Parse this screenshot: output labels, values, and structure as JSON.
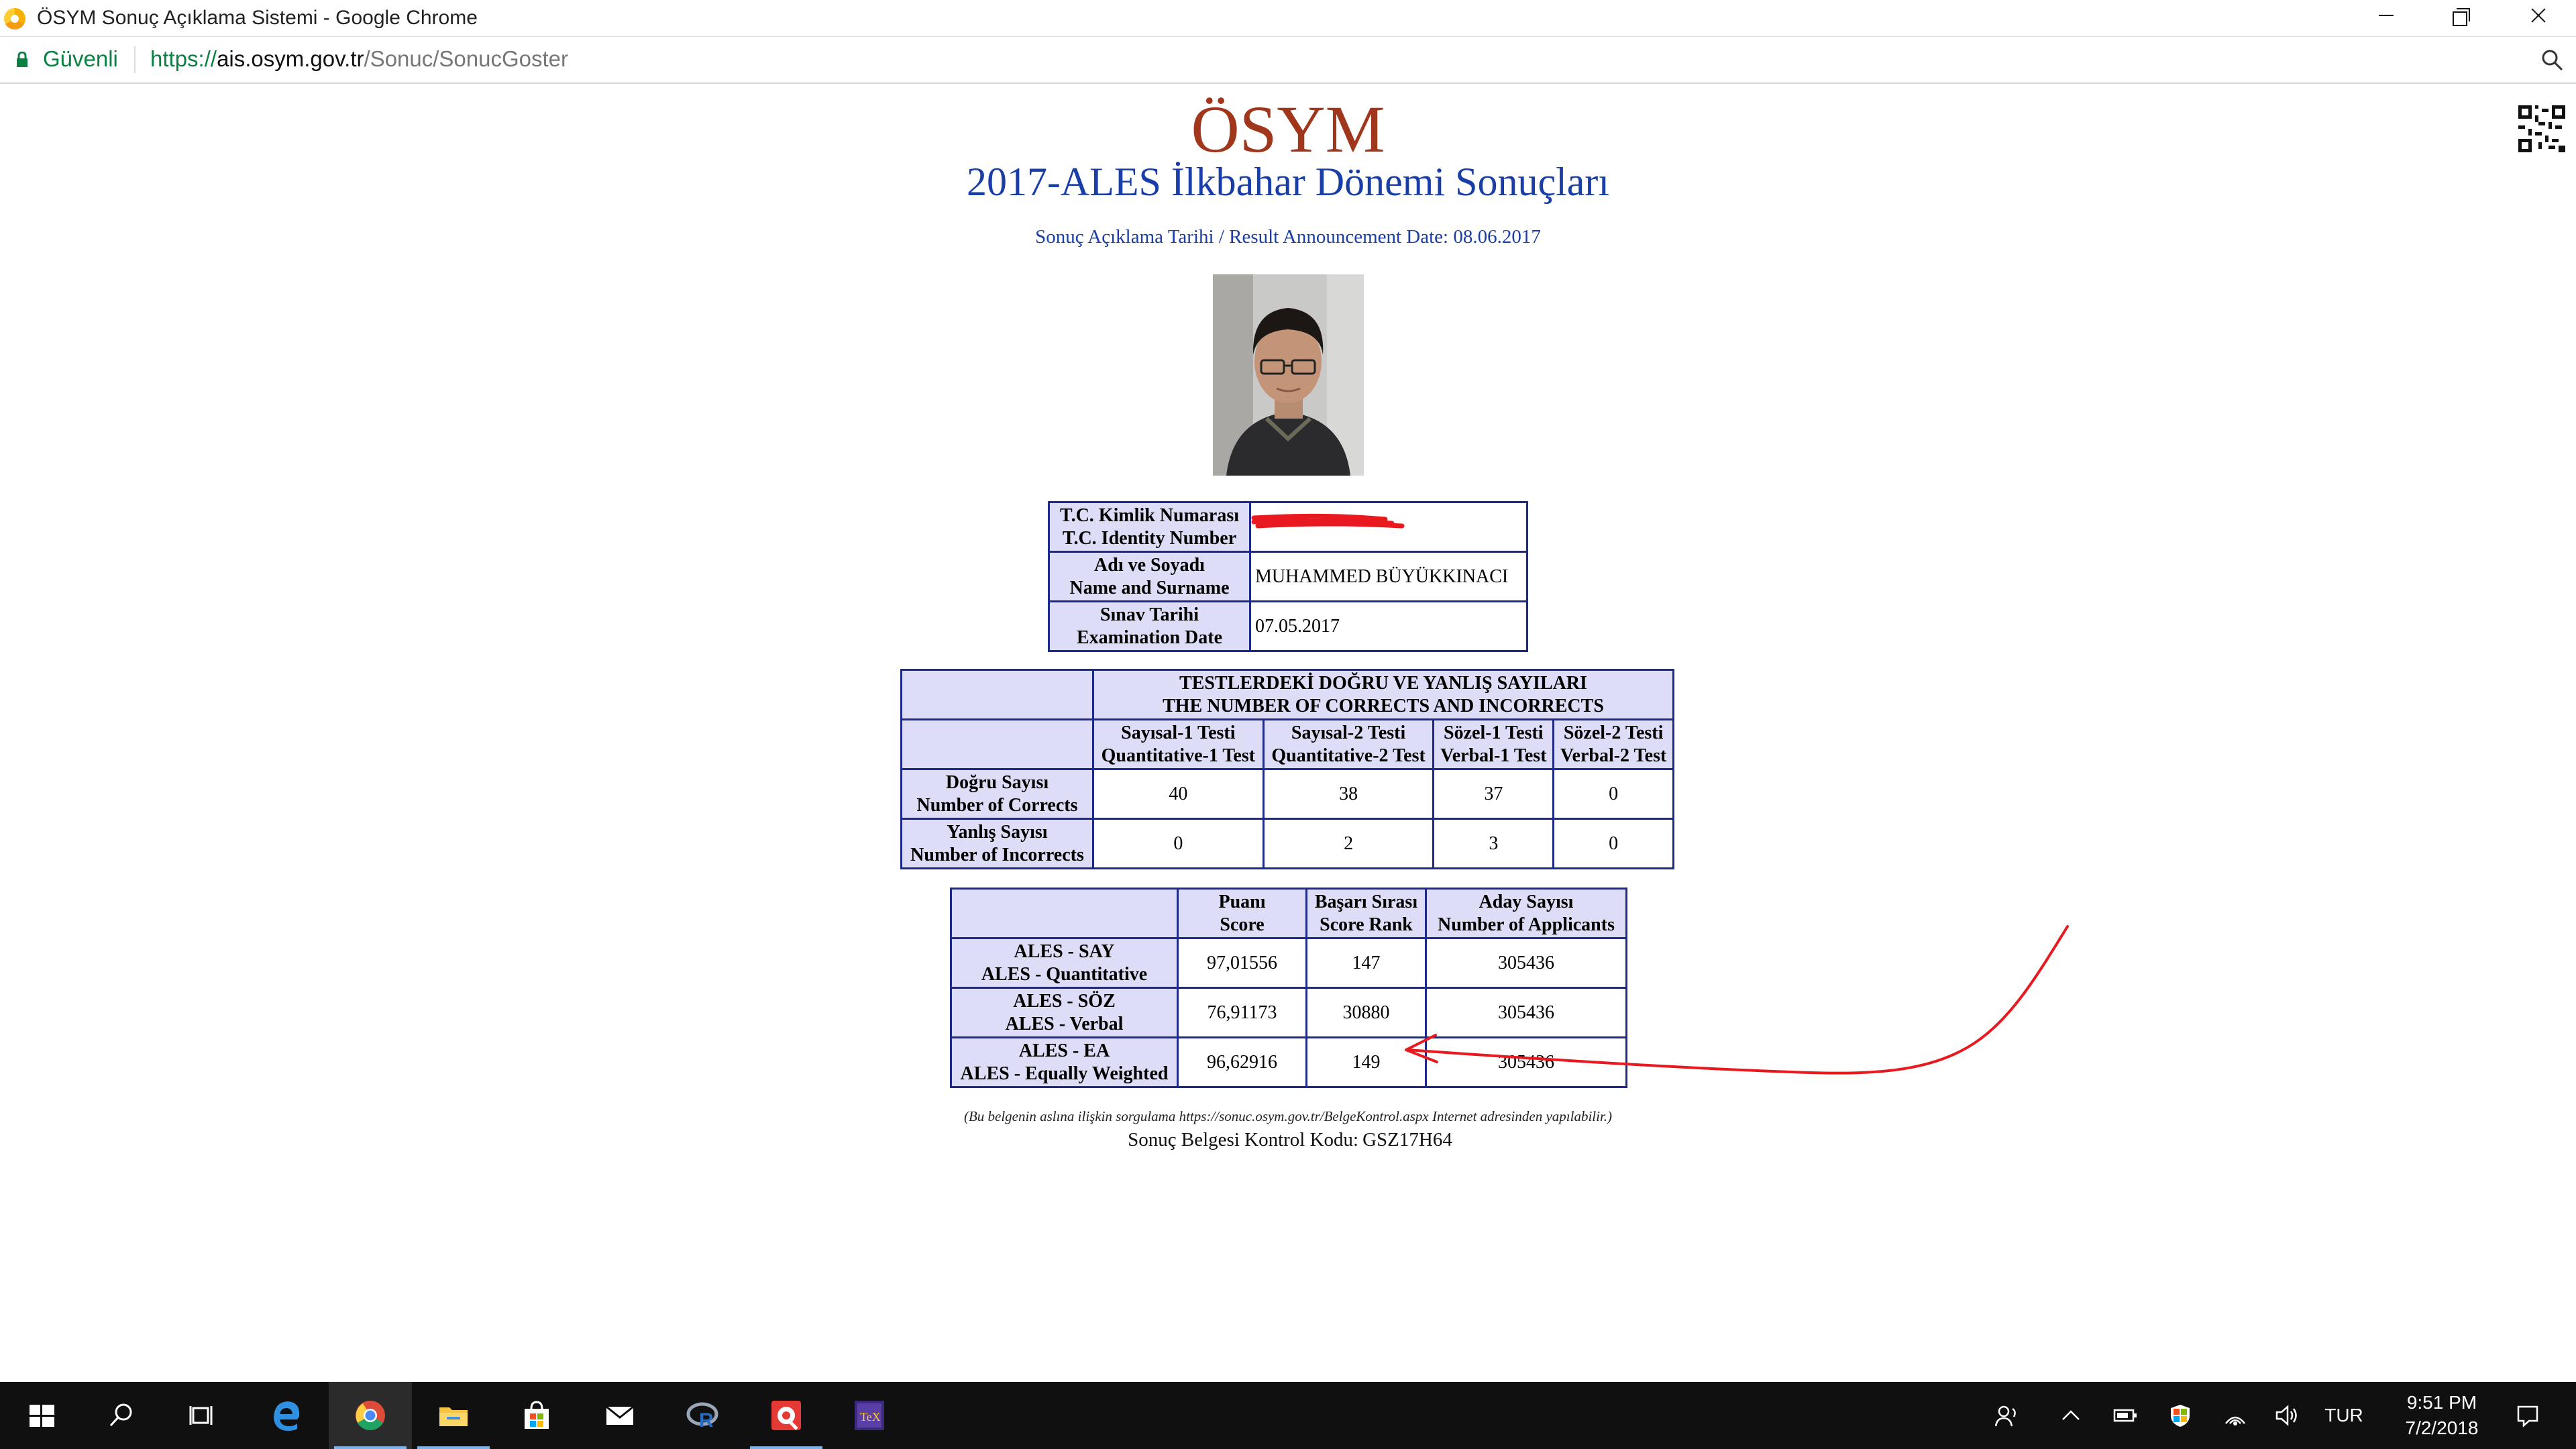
{
  "window": {
    "title": "ÖSYM Sonuç Açıklama Sistemi - Google Chrome"
  },
  "addressbar": {
    "secure_label": "Güvenli",
    "url_scheme": "https://",
    "url_host": "ais.osym.gov.tr",
    "url_path": "/Sonuc/SonucGoster"
  },
  "page": {
    "logo_text": "ÖSYM",
    "title": "2017-ALES İlkbahar Dönemi Sonuçları",
    "announcement": "Sonuç Açıklama Tarihi / Result Announcement Date: 08.06.2017",
    "identity": {
      "rows": [
        {
          "label_tr": "T.C. Kimlik Numarası",
          "label_en": "T.C. Identity Number",
          "value": ""
        },
        {
          "label_tr": "Adı ve Soyadı",
          "label_en": "Name and Surname",
          "value": "MUHAMMED BÜYÜKKINACI"
        },
        {
          "label_tr": "Sınav Tarihi",
          "label_en": "Examination Date",
          "value": "07.05.2017"
        }
      ]
    },
    "answers": {
      "heading_tr": "TESTLERDEKİ DOĞRU VE YANLIŞ SAYILARI",
      "heading_en": "THE NUMBER OF CORRECTS AND INCORRECTS",
      "columns": [
        {
          "tr": "Sayısal-1 Testi",
          "en": "Quantitative-1 Test"
        },
        {
          "tr": "Sayısal-2 Testi",
          "en": "Quantitative-2 Test"
        },
        {
          "tr": "Sözel-1 Testi",
          "en": "Verbal-1 Test"
        },
        {
          "tr": "Sözel-2 Testi",
          "en": "Verbal-2 Test"
        }
      ],
      "rows": [
        {
          "label_tr": "Doğru Sayısı",
          "label_en": "Number of Corrects",
          "values": [
            "40",
            "38",
            "37",
            "0"
          ]
        },
        {
          "label_tr": "Yanlış Sayısı",
          "label_en": "Number of Incorrects",
          "values": [
            "0",
            "2",
            "3",
            "0"
          ]
        }
      ]
    },
    "scores": {
      "columns": [
        {
          "tr": "Puanı",
          "en": "Score"
        },
        {
          "tr": "Başarı Sırası",
          "en": "Score Rank"
        },
        {
          "tr": "Aday Sayısı",
          "en": "Number of Applicants"
        }
      ],
      "rows": [
        {
          "label_tr": "ALES - SAY",
          "label_en": "ALES - Quantitative",
          "score": "97,01556",
          "rank": "147",
          "applicants": "305436"
        },
        {
          "label_tr": "ALES - SÖZ",
          "label_en": "ALES - Verbal",
          "score": "76,91173",
          "rank": "30880",
          "applicants": "305436"
        },
        {
          "label_tr": "ALES - EA",
          "label_en": "ALES - Equally Weighted",
          "score": "96,62916",
          "rank": "149",
          "applicants": "305436"
        }
      ]
    },
    "note": "(Bu belgenin aslına ilişkin sorgulama https://sonuc.osym.gov.tr/BelgeKontrol.aspx Internet adresinden yapılabilir.)",
    "control_code_label": "Sonuç Belgesi Kontrol Kodu:",
    "control_code": "GSZ17H64"
  },
  "taskbar": {
    "apps": [
      "start-icon",
      "search-icon",
      "task-view-icon",
      "edge-icon",
      "chrome-icon",
      "file-explorer-icon",
      "store-icon",
      "mail-icon",
      "r-icon",
      "photo-app-icon",
      "tex-icon"
    ],
    "tray": {
      "language": "TUR",
      "time": "9:51 PM",
      "date": "7/2/2018"
    }
  },
  "colors": {
    "logo": "#a0361c",
    "title": "#1a3ea8",
    "table_border": "#1e2a8a",
    "table_header_bg": "#ddddf7",
    "annotation": "#e8191f",
    "secure_green": "#0b8043"
  }
}
